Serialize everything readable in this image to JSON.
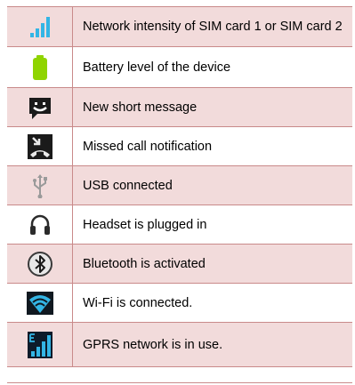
{
  "rows": [
    {
      "icon": "signal-bars-icon",
      "text": "Network intensity of SIM card 1 or SIM card 2"
    },
    {
      "icon": "battery-icon",
      "text": "Battery level of the device"
    },
    {
      "icon": "message-icon",
      "text": "New short message"
    },
    {
      "icon": "missed-call-icon",
      "text": "Missed call notification"
    },
    {
      "icon": "usb-icon",
      "text": "USB connected"
    },
    {
      "icon": "headset-icon",
      "text": "Headset is plugged in"
    },
    {
      "icon": "bluetooth-icon",
      "text": "Bluetooth is activated"
    },
    {
      "icon": "wifi-icon",
      "text": "Wi-Fi is connected."
    },
    {
      "icon": "gprs-icon",
      "text": "GPRS network is in use."
    }
  ],
  "colors": {
    "border": "#c98a8a",
    "shaded_row": "#f2dbdb",
    "signal": "#33b5e5",
    "battery": "#8fd400"
  }
}
